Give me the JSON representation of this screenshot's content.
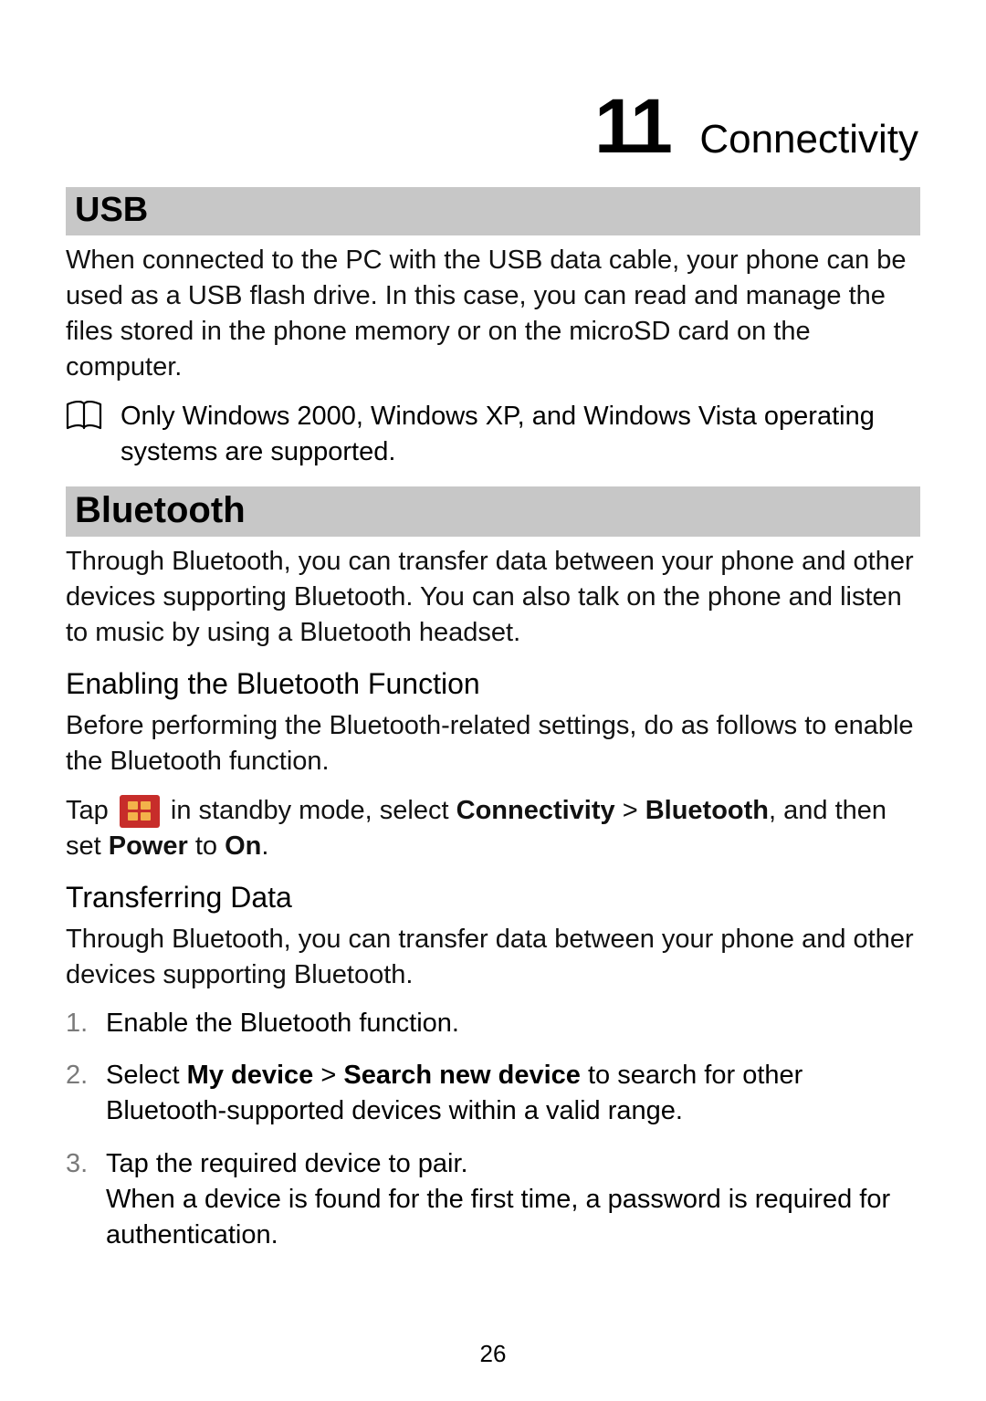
{
  "chapter": {
    "number": "11",
    "title": "Connectivity"
  },
  "sections": {
    "usb": {
      "heading": "USB",
      "body": "When connected to the PC with the USB data cable, your phone can be used as a USB flash drive. In this case, you can read and manage the files stored in the phone memory or on the microSD card on the computer.",
      "note": "Only Windows 2000, Windows XP, and Windows Vista operating systems are supported."
    },
    "bluetooth": {
      "heading": "Bluetooth",
      "body": "Through Bluetooth, you can transfer data between your phone and other devices supporting Bluetooth. You can also talk on the phone and listen to music by using a Bluetooth headset.",
      "subsections": {
        "enable": {
          "heading": "Enabling the Bluetooth Function",
          "body": "Before performing the Bluetooth-related settings, do as follows to enable the Bluetooth function.",
          "tap_prefix": "Tap ",
          "tap_middle": " in standby mode, select ",
          "path1": "Connectivity",
          "gt1": " > ",
          "path2": "Bluetooth",
          "tap_suffix1": ", and then set ",
          "power": "Power",
          "tap_to": " to ",
          "on": "On",
          "period": "."
        },
        "transfer": {
          "heading": "Transferring Data",
          "body": "Through Bluetooth, you can transfer data between your phone and other devices supporting Bluetooth.",
          "steps": {
            "s1": "Enable the Bluetooth function.",
            "s2_prefix": "Select ",
            "s2_b1": "My device",
            "s2_gt": " > ",
            "s2_b2": "Search new device",
            "s2_suffix": " to search for other Bluetooth-supported devices within a valid range.",
            "s3_line1": "Tap the required device to pair.",
            "s3_line2": "When a device is found for the first time, a password is required for authentication."
          }
        }
      }
    }
  },
  "page_number": "26"
}
